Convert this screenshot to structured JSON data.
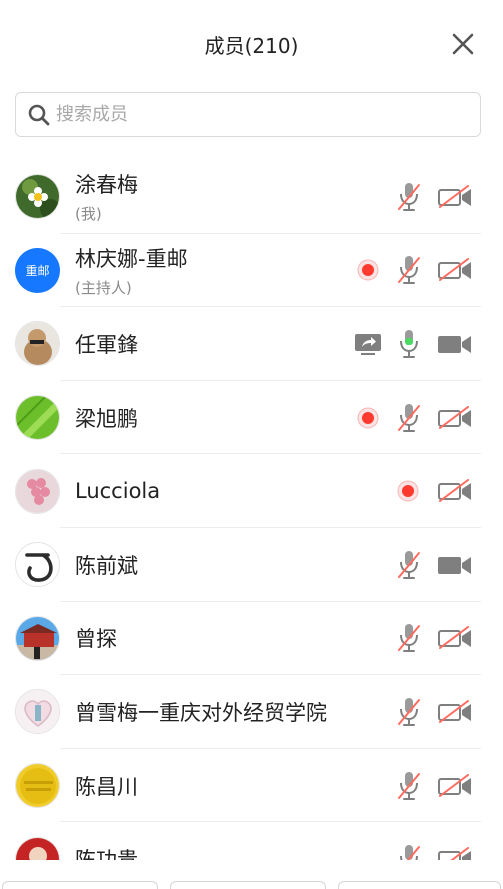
{
  "header": {
    "title": "成员(210)",
    "close_icon": "close-icon"
  },
  "search": {
    "placeholder": "搜索成员",
    "value": ""
  },
  "colors": {
    "accent": "#1677ff",
    "record": "#ff3b30",
    "muted_slash": "#ff6b5f",
    "icon_gray": "#7f7f7f",
    "mic_active": "#4cd964"
  },
  "members": [
    {
      "name": "涂春梅",
      "sub": "(我)",
      "avatar": "flower-photo",
      "recording": false,
      "sharing": false,
      "mic": "muted",
      "camera": "off"
    },
    {
      "name": "林庆娜-重邮",
      "sub": "(主持人)",
      "avatar_text": "重邮",
      "recording": true,
      "sharing": false,
      "mic": "muted",
      "camera": "off"
    },
    {
      "name": "任軍鋒",
      "sub": "",
      "avatar": "statue-photo",
      "recording": false,
      "sharing": true,
      "mic": "active",
      "camera": "on"
    },
    {
      "name": "梁旭鹏",
      "sub": "",
      "avatar": "leaf-photo",
      "recording": true,
      "sharing": false,
      "mic": "muted",
      "camera": "off"
    },
    {
      "name": "Lucciola",
      "sub": "",
      "avatar": "pink-photo",
      "recording": true,
      "sharing": false,
      "mic": "none",
      "camera": "off"
    },
    {
      "name": "陈前斌",
      "sub": "",
      "avatar": "letter-photo",
      "recording": false,
      "sharing": false,
      "mic": "muted",
      "camera": "on"
    },
    {
      "name": "曾探",
      "sub": "",
      "avatar": "temple-photo",
      "recording": false,
      "sharing": false,
      "mic": "muted",
      "camera": "off"
    },
    {
      "name": "曾雪梅一重庆对外经贸学院",
      "sub": "",
      "avatar": "heart-photo",
      "recording": false,
      "sharing": false,
      "mic": "muted",
      "camera": "off"
    },
    {
      "name": "陈昌川",
      "sub": "",
      "avatar": "gold-photo",
      "recording": false,
      "sharing": false,
      "mic": "muted",
      "camera": "off"
    },
    {
      "name": "陈功贵",
      "sub": "",
      "avatar": "person-photo",
      "recording": false,
      "sharing": false,
      "mic": "muted",
      "camera": "off"
    }
  ]
}
